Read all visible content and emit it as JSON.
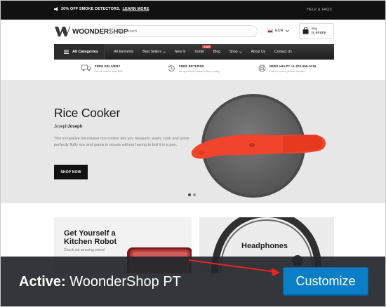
{
  "promo": {
    "text": "20% OFF SMOKE DETECTORS.",
    "link": "LEARN MORE",
    "help": "HELP & FAQS"
  },
  "header": {
    "logo_a": "WOONDER",
    "logo_b": "SHOP",
    "search_placeholder": "Search",
    "currency": "EUR",
    "bag_label": "Bag",
    "bag_status": "is empty"
  },
  "nav": {
    "all_categories": "All Categories",
    "items": [
      "All Elements",
      "Best Sellers",
      "New In",
      "Outlet",
      "Blog",
      "Shop",
      "About Us",
      "Contact Us"
    ],
    "sale_badge": "SALE"
  },
  "features": [
    {
      "title": "FREE DELIVERY",
      "sub": "On all orders over $98",
      "icon": "truck-icon"
    },
    {
      "title": "FREE RETURNS",
      "sub": "No questions asked return policy",
      "icon": "return-icon"
    },
    {
      "title": "NEED HELP? +1-202-555-0136",
      "sub": "Call us a free phone number",
      "icon": "support-icon"
    }
  ],
  "hero": {
    "title": "Rice Cooker",
    "brand_a": "Joseph",
    "brand_b": "Joseph",
    "description": "This innovative microwave rice cooker lets you measure, wash, cook and serve perfectly fluffy rice and grains in minute without having to boil it in a pan.",
    "button": "SHOP NOW",
    "colors": {
      "accent": "#f0442d",
      "background": "#e7e7e7"
    }
  },
  "cards": {
    "card1_title": "Get Yourself a Kitchen Robot",
    "card1_sub": "Check out amazing prices!",
    "card2_title": "Headphones"
  },
  "overlay": {
    "active_label": "Active:",
    "theme_name": "WoonderShop PT",
    "customize": "Customize",
    "colors": {
      "button": "#0a7fc7",
      "arrow": "#e22"
    }
  }
}
